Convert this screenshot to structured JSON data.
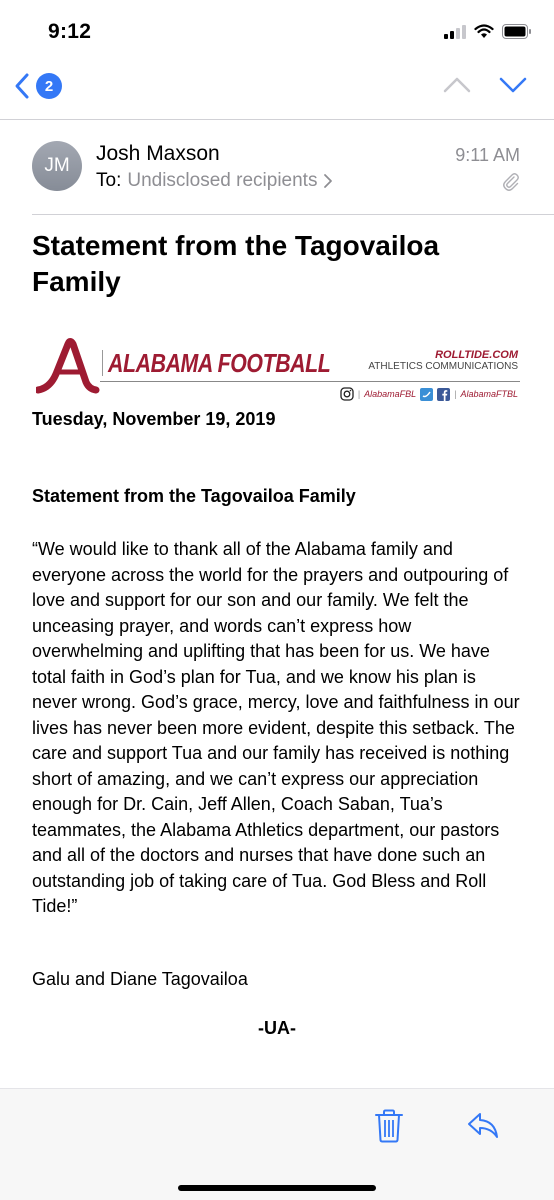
{
  "status_bar": {
    "time": "9:12"
  },
  "nav": {
    "unread_count": "2"
  },
  "header": {
    "avatar_initials": "JM",
    "sender": "Josh Maxson",
    "to_label": "To:",
    "recipients": "Undisclosed recipients",
    "time": "9:11 AM"
  },
  "email": {
    "subject": "Statement from the Tagovailoa Family",
    "banner": {
      "title": "ALABAMA FOOTBALL",
      "site": "ROLLTIDE.COM",
      "department": "ATHLETICS COMMUNICATIONS",
      "handle_1": "AlabamaFBL",
      "handle_2": "AlabamaFTBL"
    },
    "date": "Tuesday, November 19, 2019",
    "heading": "Statement from the Tagovailoa Family",
    "body": "“We would like to thank all of the Alabama family and everyone across the world for the prayers and outpouring of love and support for our son and our family. We felt the unceasing prayer, and words can’t express how overwhelming and uplifting that has been for us. We have total faith in God’s plan for Tua, and we know his plan is never wrong. God’s grace, mercy, love and faithfulness in our lives has never been more evident, despite this setback. The care and support Tua and our family has received is nothing short of amazing, and we can’t express our appreciation enough for Dr. Cain, Jeff Allen, Coach Saban, Tua’s teammates, the Alabama Athletics department, our pastors and all of the doctors and nurses that have done such an outstanding job of taking care of Tua. God Bless and Roll Tide!”",
    "signature": "Galu and Diane Tagovailoa",
    "footer": "-UA-"
  },
  "colors": {
    "accent": "#3478f6",
    "crimson": "#9e1b32",
    "secondary_text": "#8e8e93"
  },
  "icons": {
    "back": "chevron-left-icon",
    "up": "chevron-up-icon",
    "down": "chevron-down-icon",
    "attachment": "paperclip-icon",
    "trash": "trash-icon",
    "reply": "reply-icon"
  }
}
